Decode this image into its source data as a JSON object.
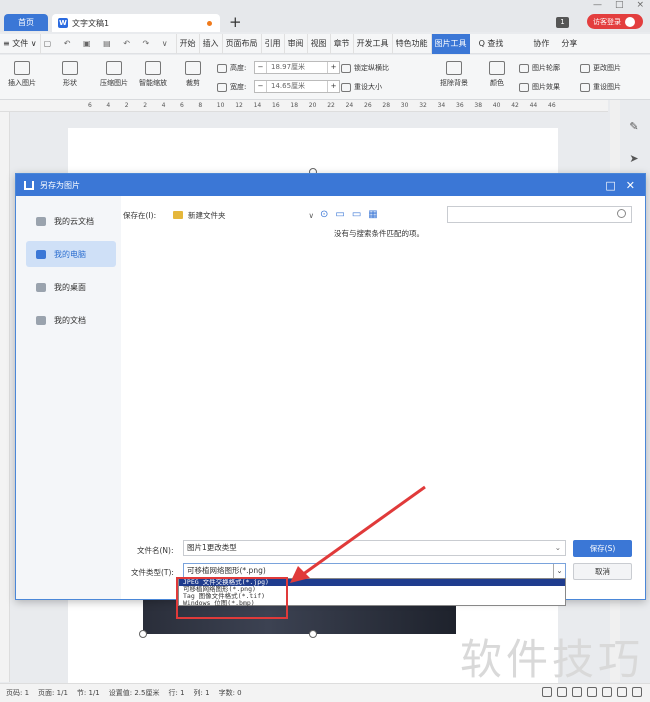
{
  "titlebar": {
    "home_tab": "首页",
    "doc_tab": "文字文稿1",
    "new_tab": "+",
    "page_badge": "1",
    "login": "访客登录",
    "win_controls": [
      "—",
      "□",
      "×"
    ]
  },
  "menubar": {
    "items": [
      "≡ 文件 ∨",
      "开始",
      "插入",
      "页面布局",
      "引用",
      "审阅",
      "视图",
      "章节",
      "开发工具",
      "特色功能",
      "图片工具"
    ],
    "find": "Q 查找",
    "collab": "协作",
    "share": "分享"
  },
  "ribbon": {
    "insert_image": "插入图片",
    "shape": "形状",
    "compress": "压缩图片",
    "smart_scale": "智能缩放",
    "crop": "裁剪",
    "height_label": "高度:",
    "height_value": "18.97厘米",
    "width_label": "宽度:",
    "width_value": "14.65厘米",
    "lock_ratio": "锁定纵横比",
    "reset_size": "重设大小",
    "remove_bg": "抠除背景",
    "color": "颜色",
    "outline": "图片轮廓",
    "effect": "图片效果",
    "change_image": "更改图片",
    "reset_image": "重设图片"
  },
  "ruler": {
    "ticks": [
      "6",
      "4",
      "2",
      "2",
      "4",
      "6",
      "8",
      "10",
      "12",
      "14",
      "16",
      "18",
      "20",
      "22",
      "24",
      "26",
      "28",
      "30",
      "32",
      "34",
      "36",
      "38",
      "40",
      "42",
      "44",
      "46"
    ]
  },
  "dialog": {
    "title": "另存为图片",
    "sidebar": [
      "我的云文档",
      "我的电脑",
      "我的桌面",
      "我的文档"
    ],
    "location_label": "保存在(I):",
    "location_value": "新建文件夹",
    "no_result": "没有与搜索条件匹配的项。",
    "filename_label": "文件名(N):",
    "filename_value": "图片1更改类型",
    "filetype_label": "文件类型(T):",
    "filetype_value": "可移植网络图形(*.png)",
    "save_button": "保存(S)",
    "cancel_button": "取消",
    "filetype_options": [
      "JPEG 文件交换格式(*.jpg)",
      "可移植网络图形(*.png)",
      "Tag 图像文件格式(*.tif)",
      "Windows 位图(*.bmp)"
    ]
  },
  "statusbar": {
    "items": [
      "页码: 1",
      "页面: 1/1",
      "节: 1/1",
      "设置值: 2.5厘米",
      "行: 1",
      "列: 1",
      "字数: 0"
    ]
  },
  "watermark": "软件技巧",
  "colors": {
    "accent": "#3b77d6",
    "highlight_red": "#e03a3a",
    "login_red": "#e33e3e"
  }
}
